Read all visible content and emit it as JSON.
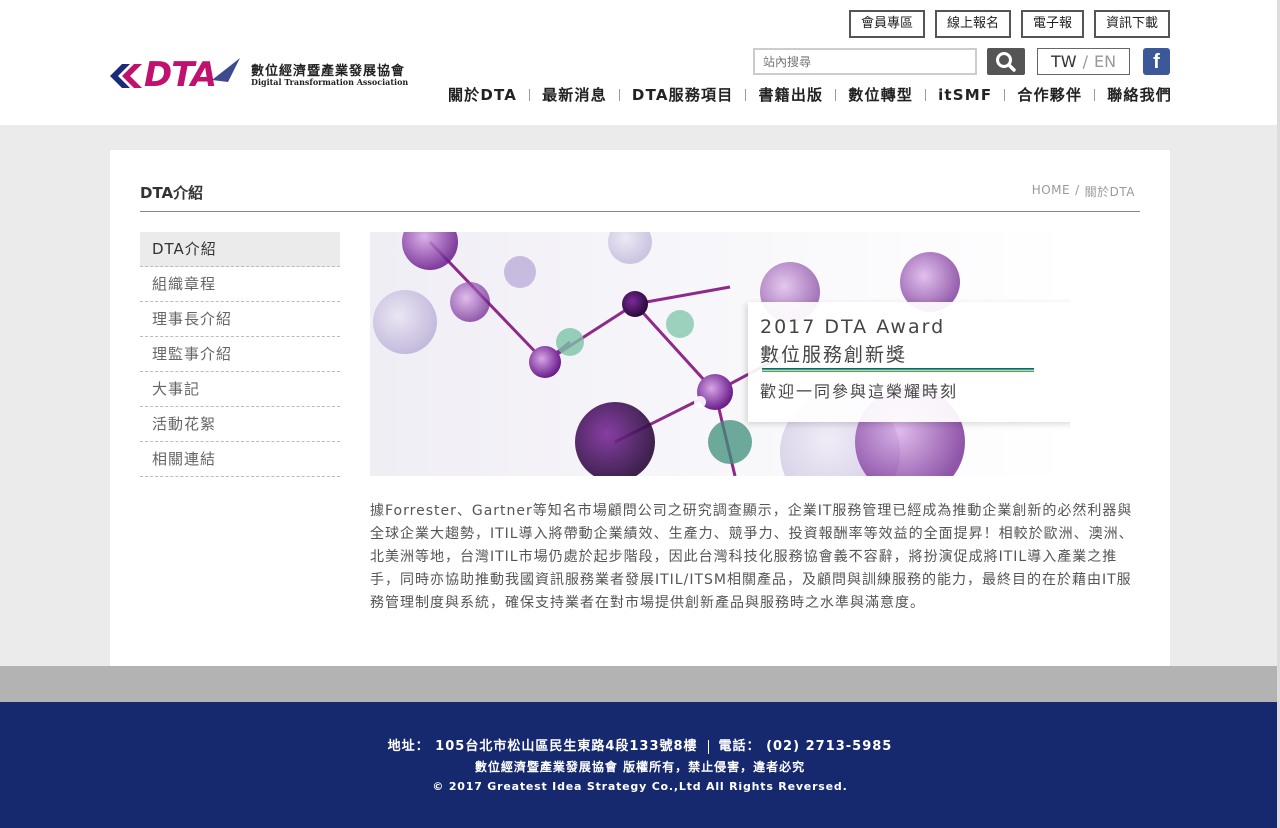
{
  "logo": {
    "brand": "DTA",
    "name_zh": "數位經濟暨產業發展協會",
    "name_en": "Digital Transformation Association"
  },
  "top_links": [
    "會員專區",
    "線上報名",
    "電子報",
    "資訊下載"
  ],
  "search": {
    "placeholder": "站內搜尋"
  },
  "lang": {
    "tw": "TW",
    "sep": "/",
    "en": "EN"
  },
  "facebook": {
    "icon": "facebook-icon",
    "glyph": "f"
  },
  "nav": [
    "關於DTA",
    "最新消息",
    "DTA服務項目",
    "書籍出版",
    "數位轉型",
    "itSMF",
    "合作夥伴",
    "聯絡我們"
  ],
  "page": {
    "title": "DTA介紹",
    "breadcrumb": {
      "home": "HOME",
      "sep": "/",
      "current": "關於DTA"
    }
  },
  "sidemenu": [
    "DTA介紹",
    "組織章程",
    "理事長介紹",
    "理監事介紹",
    "大事記",
    "活動花絮",
    "相關連結"
  ],
  "banner": {
    "title_en": "2017 DTA Award",
    "title_zh": "數位服務創新獎",
    "subtitle": "歡迎一同參與這榮耀時刻"
  },
  "intro": "據Forrester、Gartner等知名市場顧問公司之研究調查顯示，企業IT服務管理已經成為推動企業創新的必然利器與全球企業大趨勢，ITIL導入將帶動企業績效、生產力、競爭力、投資報酬率等效益的全面提昇！相較於歐洲、澳洲、北美洲等地，台灣ITIL市場仍處於起步階段，因此台灣科技化服務協會義不容辭，將扮演促成將ITIL導入產業之推手，同時亦協助推動我國資訊服務業者發展ITIL/ITSM相關產品，及顧問與訓練服務的能力，最終目的在於藉由IT服務管理制度與系統，確保支持業者在對市場提供創新產品與服務時之水準與滿意度。",
  "footer": {
    "address": "地址： 105台北市松山區民生東路4段133號8樓",
    "phone": "電話： (02) 2713-5985",
    "rights_zh": "數位經濟暨產業發展協會 版權所有，禁止侵害，違者必究",
    "copyright": "© 2017 Greatest Idea Strategy Co.,Ltd All Rights Reversed."
  },
  "colors": {
    "footer_bg": "#16296e",
    "logo_magenta": "#c0116e",
    "logo_navy": "#1b2a7a",
    "facebook": "#3b5998"
  }
}
